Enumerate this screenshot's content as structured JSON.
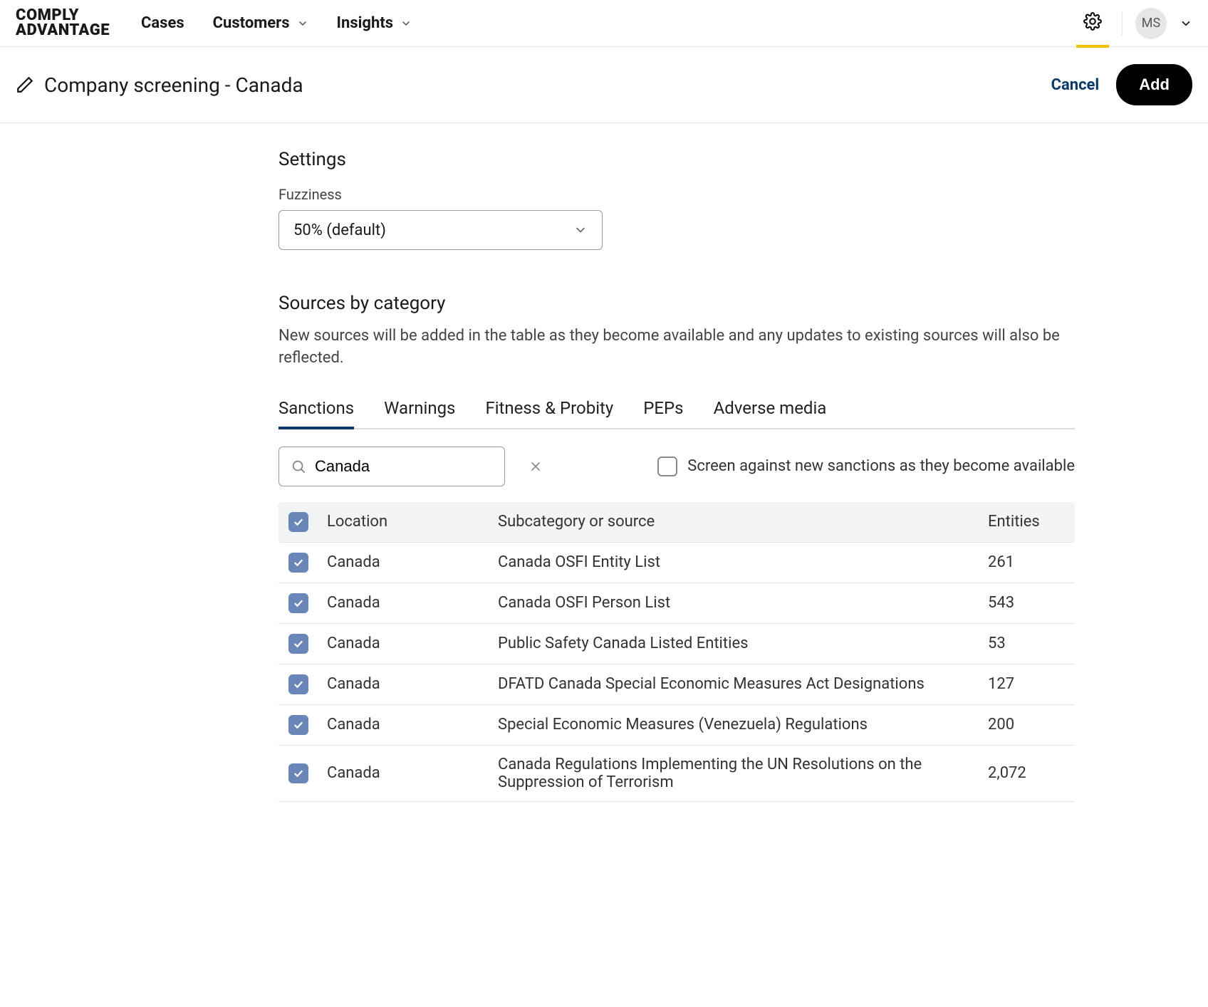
{
  "logo": {
    "line1": "COMPLY",
    "line2": "ADVANTAGE"
  },
  "nav": {
    "cases": "Cases",
    "customers": "Customers",
    "insights": "Insights"
  },
  "avatar_initials": "MS",
  "page": {
    "title": "Company screening - Canada",
    "cancel": "Cancel",
    "add": "Add"
  },
  "settings": {
    "heading": "Settings",
    "fuzziness_label": "Fuzziness",
    "fuzziness_value": "50% (default)"
  },
  "sources": {
    "heading": "Sources by category",
    "description": "New sources will be added in the table as they become available and any updates to existing sources will also be reflected."
  },
  "tabs": {
    "sanctions": "Sanctions",
    "warnings": "Warnings",
    "fitness": "Fitness & Probity",
    "peps": "PEPs",
    "adverse": "Adverse media"
  },
  "search": {
    "value": "Canada"
  },
  "screen_new_label": "Screen against new sanctions as they become available",
  "table": {
    "headers": {
      "location": "Location",
      "source": "Subcategory or source",
      "entities": "Entities"
    },
    "rows": [
      {
        "location": "Canada",
        "source": "Canada OSFI Entity List",
        "entities": "261"
      },
      {
        "location": "Canada",
        "source": "Canada OSFI Person List",
        "entities": "543"
      },
      {
        "location": "Canada",
        "source": "Public Safety Canada Listed Entities",
        "entities": "53"
      },
      {
        "location": "Canada",
        "source": "DFATD Canada Special Economic Measures Act Designations",
        "entities": "127"
      },
      {
        "location": "Canada",
        "source": "Special Economic Measures (Venezuela) Regulations",
        "entities": "200"
      },
      {
        "location": "Canada",
        "source": "Canada Regulations Implementing the UN Resolutions on the Suppression of Terrorism",
        "entities": "2,072"
      }
    ]
  }
}
